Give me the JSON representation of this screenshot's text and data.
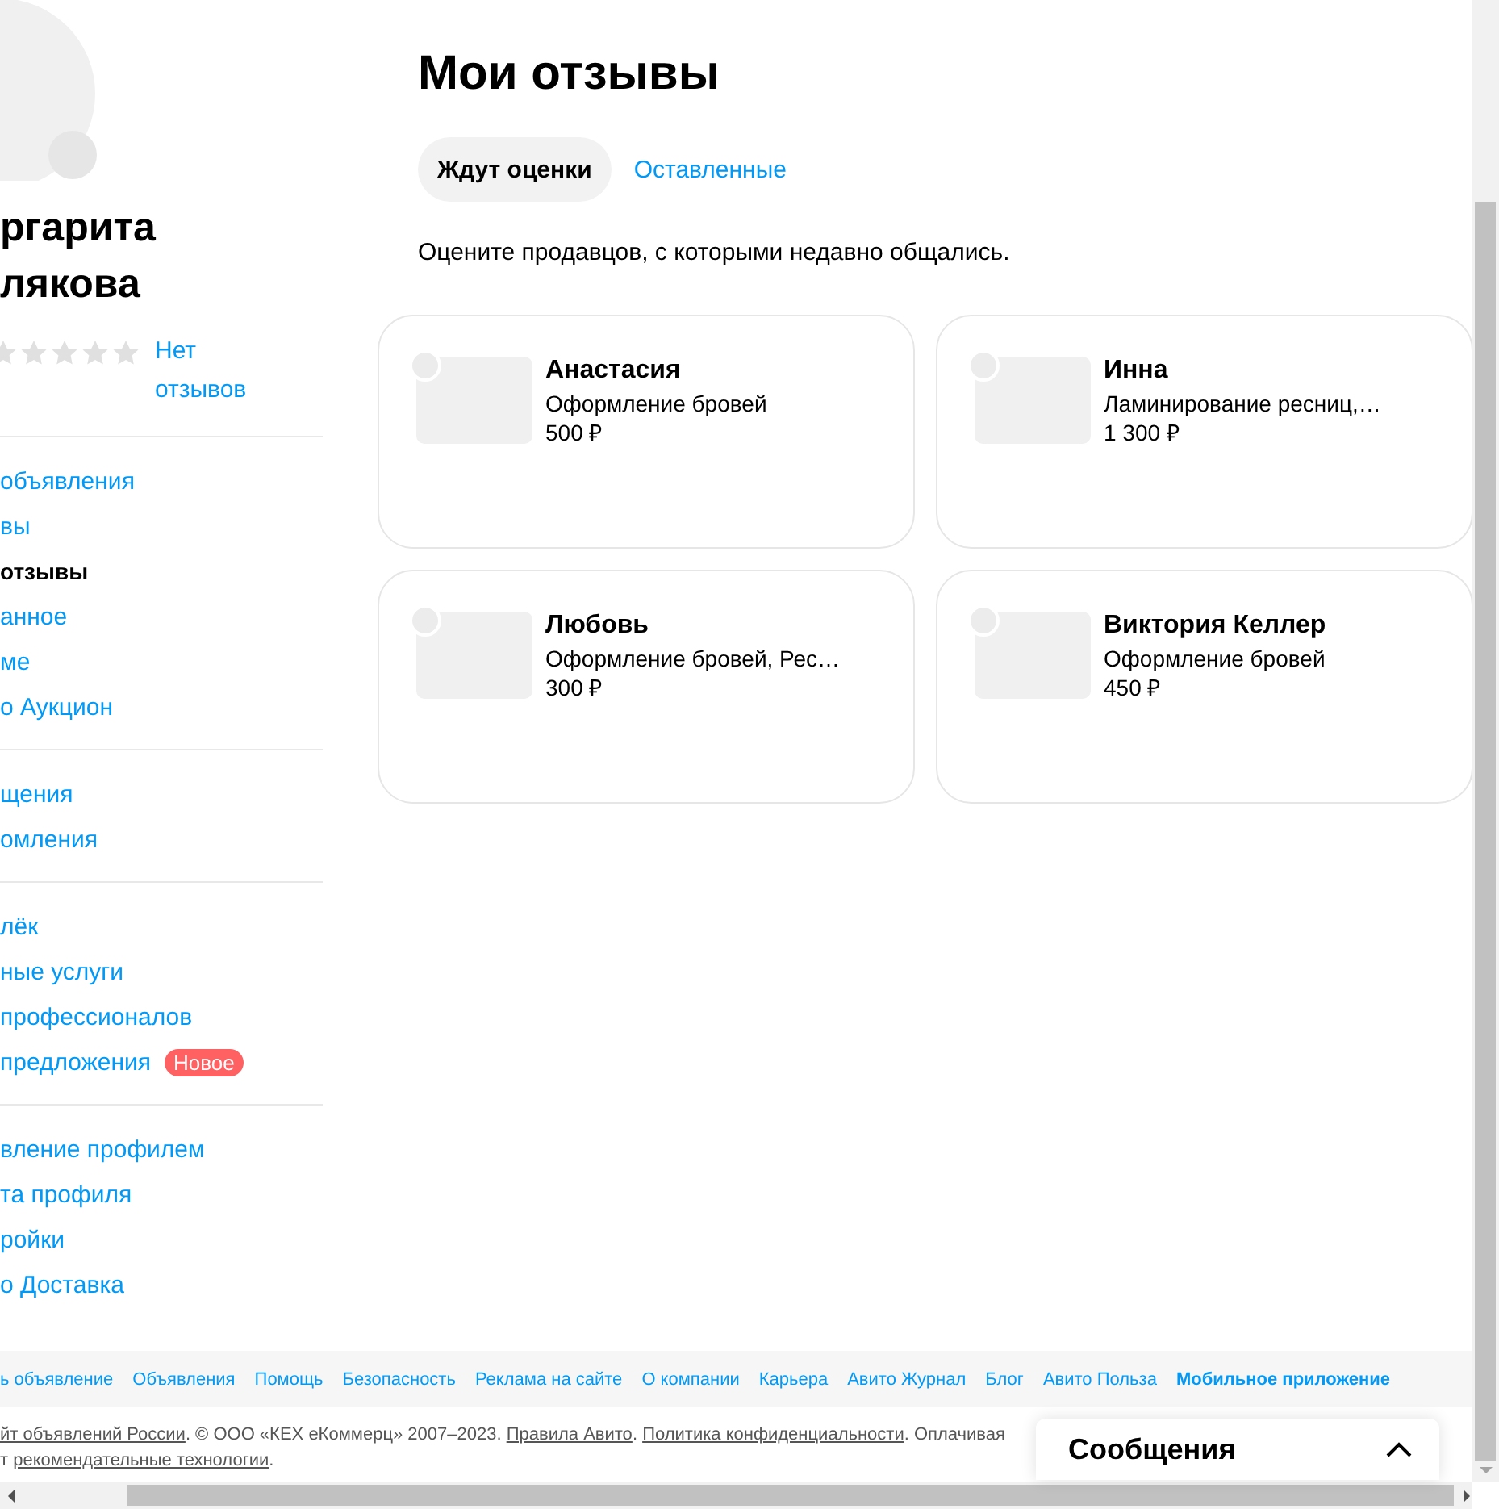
{
  "sidebar": {
    "name_lines": [
      "ргарита",
      "лякова"
    ],
    "stars": 0,
    "reviews_link": "Нет отзывов",
    "sections": [
      {
        "items": [
          {
            "label": "объявления",
            "selected": false
          },
          {
            "label": "вы",
            "selected": false
          },
          {
            "label": "отзывы",
            "selected": true
          },
          {
            "label": "анное",
            "selected": false
          },
          {
            "label": "ме",
            "selected": false
          },
          {
            "label": "о Аукцион",
            "selected": false
          }
        ]
      },
      {
        "items": [
          {
            "label": "щения",
            "selected": false
          },
          {
            "label": "омления",
            "selected": false
          }
        ]
      },
      {
        "items": [
          {
            "label": "лёк",
            "selected": false
          },
          {
            "label": "ные услуги",
            "selected": false
          },
          {
            "label": "профессионалов",
            "selected": false
          },
          {
            "label": "предложения",
            "selected": false,
            "badge": "Новое"
          }
        ]
      },
      {
        "items": [
          {
            "label": "вление профилем",
            "selected": false
          },
          {
            "label": "та профиля",
            "selected": false
          },
          {
            "label": "ройки",
            "selected": false
          },
          {
            "label": "о Доставка",
            "selected": false
          }
        ]
      }
    ]
  },
  "title": "Мои отзывы",
  "tabs": [
    {
      "label": "Ждут оценки",
      "selected": true
    },
    {
      "label": "Оставленные",
      "selected": false
    }
  ],
  "hint": "Оцените продавцов, с которыми недавно общались.",
  "cards": [
    {
      "name": "Анастасия",
      "service": "Оформление бровей",
      "price": "500 ₽"
    },
    {
      "name": "Инна",
      "service": "Ламинирование ресниц,…",
      "price": "1 300 ₽"
    },
    {
      "name": "Любовь",
      "service": "Оформление бровей, Рес…",
      "price": "300 ₽"
    },
    {
      "name": "Виктория Келлер",
      "service": "Оформление бровей",
      "price": "450 ₽"
    }
  ],
  "footer": {
    "links": [
      {
        "label": "ь объявление",
        "bold": false
      },
      {
        "label": "Объявления",
        "bold": false
      },
      {
        "label": "Помощь",
        "bold": false
      },
      {
        "label": "Безопасность",
        "bold": false
      },
      {
        "label": "Реклама на сайте",
        "bold": false
      },
      {
        "label": "О компании",
        "bold": false
      },
      {
        "label": "Карьера",
        "bold": false
      },
      {
        "label": "Авито Журнал",
        "bold": false
      },
      {
        "label": "Блог",
        "bold": false
      },
      {
        "label": "Авито Польза",
        "bold": false
      },
      {
        "label": "Мобильное приложение",
        "bold": true
      }
    ],
    "legal_lines": [
      [
        {
          "text": "йт объявлений России",
          "link": true
        },
        {
          "text": ". © ООО «КЕХ eКоммерц» 2007–2023. ",
          "link": false
        },
        {
          "text": "Правила Авито",
          "link": true
        },
        {
          "text": ". ",
          "link": false
        },
        {
          "text": "Политика конфиденциальности",
          "link": true
        },
        {
          "text": ". Оплачивая",
          "link": false
        }
      ],
      [
        {
          "text": "т ",
          "link": false
        },
        {
          "text": "рекомендательные технологии",
          "link": true
        },
        {
          "text": ".",
          "link": false
        }
      ]
    ]
  },
  "messages_panel": {
    "title": "Сообщения",
    "expanded": false
  }
}
